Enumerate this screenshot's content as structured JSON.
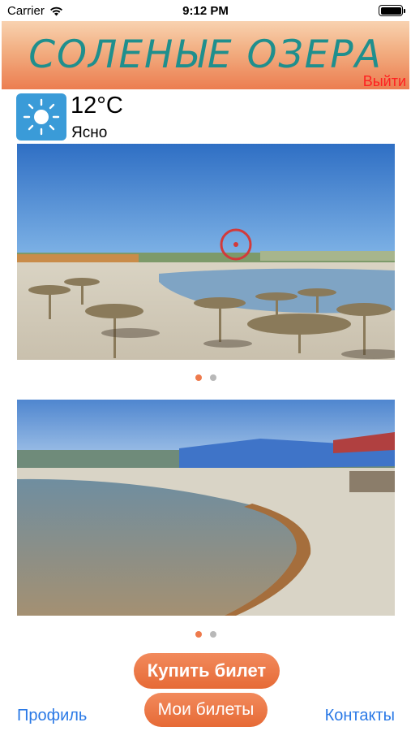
{
  "status_bar": {
    "carrier": "Carrier",
    "time": "9:12 PM",
    "wifi_icon": "wifi-icon",
    "battery_icon": "battery-icon"
  },
  "header": {
    "title": "СОЛЕНЫЕ ОЗЕРА",
    "logout_label": "Выйти"
  },
  "weather": {
    "icon": "sun-icon",
    "temperature": "12°C",
    "condition": "Ясно"
  },
  "carousels": [
    {
      "page_count": 2,
      "active_index": 0
    },
    {
      "page_count": 2,
      "active_index": 0
    }
  ],
  "buttons": {
    "buy_ticket": "Купить билет",
    "my_tickets": "Мои билеты"
  },
  "links": {
    "profile": "Профиль",
    "contacts": "Контакты"
  },
  "colors": {
    "header_text": "#1f8f8d",
    "logout": "#ff2020",
    "accent": "#ee7a4c",
    "link": "#2a79e6"
  }
}
